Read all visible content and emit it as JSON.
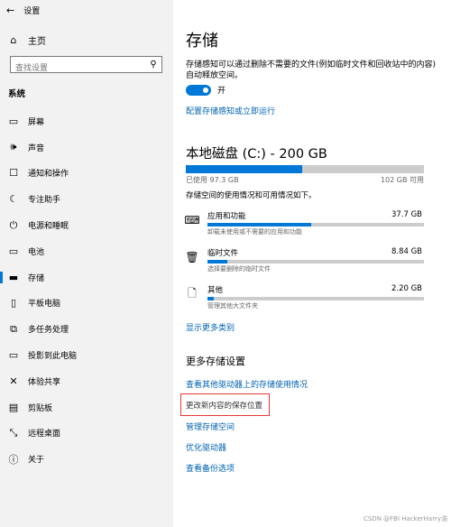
{
  "window": {
    "title": "设置",
    "back_icon": "back-arrow-icon"
  },
  "sidebar": {
    "home_label": "主页",
    "search_placeholder": "查找设置",
    "section": "系统",
    "items": [
      {
        "label": "屏幕",
        "icon": "monitor-icon",
        "glyph": "▭"
      },
      {
        "label": "声音",
        "icon": "speaker-icon",
        "glyph": "🕪"
      },
      {
        "label": "通知和操作",
        "icon": "notification-icon",
        "glyph": "☐"
      },
      {
        "label": "专注助手",
        "icon": "moon-icon",
        "glyph": "☾"
      },
      {
        "label": "电源和睡眠",
        "icon": "power-icon",
        "glyph": "⏻"
      },
      {
        "label": "电池",
        "icon": "battery-icon",
        "glyph": "▭"
      },
      {
        "label": "存储",
        "icon": "storage-icon",
        "glyph": "▬",
        "selected": true
      },
      {
        "label": "平板电脑",
        "icon": "tablet-icon",
        "glyph": "▯"
      },
      {
        "label": "多任务处理",
        "icon": "multitask-icon",
        "glyph": "⧉"
      },
      {
        "label": "投影到此电脑",
        "icon": "projector-icon",
        "glyph": "▭"
      },
      {
        "label": "体验共享",
        "icon": "share-icon",
        "glyph": "✕"
      },
      {
        "label": "剪贴板",
        "icon": "clipboard-icon",
        "glyph": "▤"
      },
      {
        "label": "远程桌面",
        "icon": "remote-desktop-icon",
        "glyph": "⤡"
      },
      {
        "label": "关于",
        "icon": "info-icon",
        "glyph": "ⓘ"
      }
    ]
  },
  "main": {
    "title": "存储",
    "sense_desc": "存储感知可以通过删除不需要的文件(例如临时文件和回收站中的内容)自动释放空间。",
    "toggle_label": "开",
    "toggle_on": true,
    "config_link": "配置存储感知或立即运行",
    "disk_title": "本地磁盘 (C:) - 200 GB",
    "disk_used": "已使用 97.3 GB",
    "disk_free": "102 GB 可用",
    "disk_used_fraction": 0.49,
    "usage_desc": "存储空间的使用情况和可用情况如下。",
    "categories": [
      {
        "name": "应用和功能",
        "size": "37.7 GB",
        "sub": "卸载未使用或不需要的应用和功能",
        "icon": "keyboard-icon",
        "glyph": "⌨",
        "fraction": 0.48
      },
      {
        "name": "临时文件",
        "size": "8.84 GB",
        "sub": "选择要删除的临时文件",
        "icon": "trash-icon",
        "glyph": "🗑",
        "fraction": 0.09
      },
      {
        "name": "其他",
        "size": "2.20 GB",
        "sub": "管理其他大文件夹",
        "icon": "file-icon",
        "glyph": "🗋",
        "fraction": 0.03
      }
    ],
    "show_more_link": "显示更多类别",
    "more_title": "更多存储设置",
    "links": {
      "view_other": "查看其他驱动器上的存储使用情况",
      "change_location": "更改新内容的保存位置",
      "manage_spaces": "管理存储空间",
      "optimize": "优化驱动器",
      "backup": "查看备份选项"
    }
  },
  "watermark": "CSDN @FBI HackerHarry浩",
  "colors": {
    "accent": "#0078d7",
    "link": "#0063b1",
    "highlight": "#e53935",
    "sidebar_bg": "#f2f2f2"
  }
}
